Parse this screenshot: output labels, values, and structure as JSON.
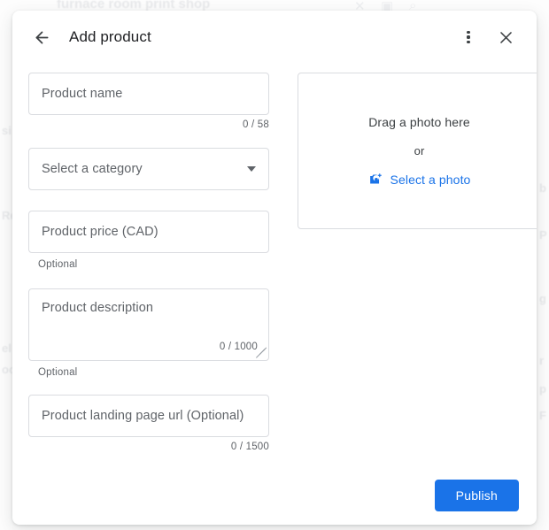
{
  "backdrop": {
    "page_title": "furnace room print shop",
    "fragments": [
      "si",
      "Re",
      "el",
      "oo",
      "b",
      "P",
      "g",
      "r",
      "p",
      "F"
    ]
  },
  "header": {
    "back_icon": "arrow-left-icon",
    "title": "Add product",
    "overflow_icon": "more-vert-icon",
    "close_icon": "close-icon"
  },
  "form": {
    "product_name": {
      "placeholder": "Product name",
      "value": "",
      "counter": "0 / 58"
    },
    "category": {
      "placeholder": "Select a category",
      "value": "",
      "caret_icon": "chevron-down-icon"
    },
    "price": {
      "placeholder": "Product price (CAD)",
      "value": "",
      "helper": "Optional"
    },
    "description": {
      "placeholder": "Product description",
      "value": "",
      "counter": "0 / 1000",
      "helper": "Optional",
      "resize_icon": "resize-grip-icon"
    },
    "landing_url": {
      "placeholder": "Product landing page url (Optional)",
      "value": "",
      "counter": "0 / 1500"
    }
  },
  "photo": {
    "drag_text": "Drag a photo here",
    "or_text": "or",
    "select_label": "Select a photo",
    "select_icon": "add-a-photo-icon"
  },
  "footer": {
    "publish_label": "Publish"
  },
  "colors": {
    "accent": "#1a73e8",
    "border": "#dadce0",
    "text_primary": "#202124",
    "text_secondary": "#5f6368"
  }
}
